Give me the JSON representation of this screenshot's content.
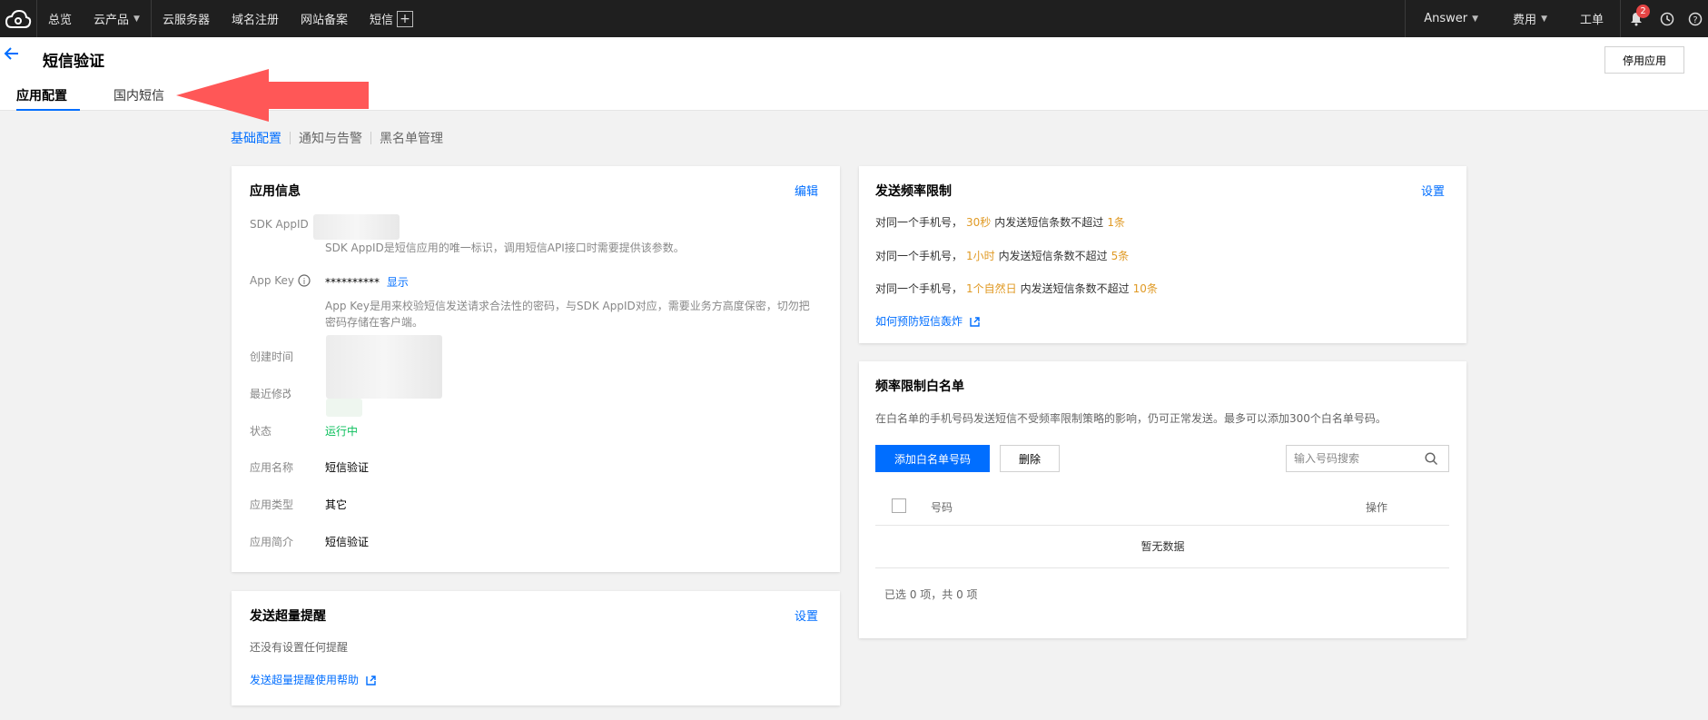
{
  "topnav": {
    "overview": "总览",
    "products": "云产品",
    "cvm": "云服务器",
    "domain": "域名注册",
    "icp": "网站备案",
    "sms": "短信",
    "account": "Answer",
    "billing": "费用",
    "ticket": "工单",
    "notif_count": "2"
  },
  "header": {
    "title": "短信验证",
    "stop_button": "停用应用",
    "tabs": [
      "应用配置",
      "国内短信"
    ]
  },
  "subnav": [
    "基础配置",
    "通知与告警",
    "黑名单管理"
  ],
  "app_info": {
    "title": "应用信息",
    "edit": "编辑",
    "sdk_appid_label": "SDK AppID",
    "sdk_appid_desc": "SDK AppID是短信应用的唯一标识，调用短信API接口时需要提供该参数。",
    "appkey_label": "App Key",
    "appkey_value": "**********",
    "appkey_show": "显示",
    "appkey_desc": "App Key是用来校验短信发送请求合法性的密码，与SDK AppID对应，需要业务方高度保密，切勿把密码存储在客户端。",
    "created_label": "创建时间",
    "modified_label": "最近修改",
    "status_label": "状态",
    "status_value": "运行中",
    "name_label": "应用名称",
    "name_value": "短信验证",
    "type_label": "应用类型",
    "type_value": "其它",
    "intro_label": "应用简介",
    "intro_value": "短信验证"
  },
  "overlimit": {
    "title": "发送超量提醒",
    "settings": "设置",
    "empty": "还没有设置任何提醒",
    "help": "发送超量提醒使用帮助"
  },
  "freq": {
    "title": "发送频率限制",
    "settings": "设置",
    "rules": [
      {
        "prefix": "对同一个手机号，",
        "period": "30秒",
        "mid": "内发送短信条数不超过",
        "count": "1条"
      },
      {
        "prefix": "对同一个手机号，",
        "period": "1小时",
        "mid": "内发送短信条数不超过",
        "count": "5条"
      },
      {
        "prefix": "对同一个手机号，",
        "period": "1个自然日",
        "mid": "内发送短信条数不超过",
        "count": "10条"
      }
    ],
    "link": "如何预防短信轰炸"
  },
  "whitelist": {
    "title": "频率限制白名单",
    "desc": "在白名单的手机号码发送短信不受频率限制策略的影响，仍可正常发送。最多可以添加300个白名单号码。",
    "add_button": "添加白名单号码",
    "delete_button": "删除",
    "search_placeholder": "输入号码搜索",
    "col_number": "号码",
    "col_action": "操作",
    "empty": "暂无数据",
    "footer": "已选 0 项，共 0 项"
  },
  "colors": {
    "accent": "#006eff",
    "highlight": "#e09a25",
    "success": "#0abf5b",
    "arrow": "#ff5757",
    "nav_bg": "#1f1f1f"
  }
}
